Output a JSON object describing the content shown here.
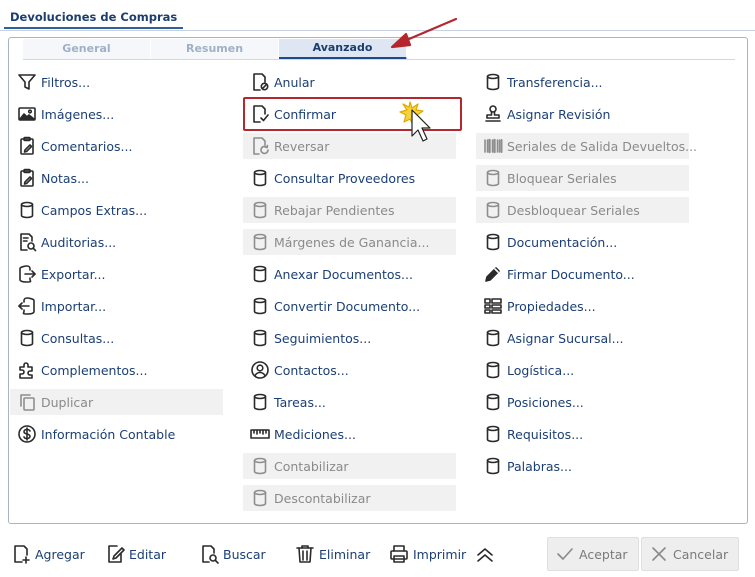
{
  "window": {
    "title": "Devoluciones de Compras"
  },
  "tabs": [
    {
      "label": "General",
      "active": false
    },
    {
      "label": "Resumen",
      "active": false
    },
    {
      "label": "Avanzado",
      "active": true
    }
  ],
  "columns": {
    "left": [
      {
        "label": "Filtros...",
        "icon": "funnel-icon",
        "enabled": true
      },
      {
        "label": "Imágenes...",
        "icon": "image-icon",
        "enabled": true
      },
      {
        "label": "Comentarios...",
        "icon": "clipboard-edit-icon",
        "enabled": true
      },
      {
        "label": "Notas...",
        "icon": "clipboard-edit-icon",
        "enabled": true
      },
      {
        "label": "Campos Extras...",
        "icon": "database-icon",
        "enabled": true
      },
      {
        "label": "Auditorias...",
        "icon": "audit-search-icon",
        "enabled": true
      },
      {
        "label": "Exportar...",
        "icon": "export-icon",
        "enabled": true
      },
      {
        "label": "Importar...",
        "icon": "import-icon",
        "enabled": true
      },
      {
        "label": "Consultas...",
        "icon": "database-icon",
        "enabled": true
      },
      {
        "label": "Complementos...",
        "icon": "puzzle-icon",
        "enabled": true
      },
      {
        "label": "Duplicar",
        "icon": "duplicate-icon",
        "enabled": false
      },
      {
        "label": "Información Contable",
        "icon": "dollar-circle-icon",
        "enabled": true
      }
    ],
    "middle": [
      {
        "label": "Anular",
        "icon": "document-cancel-icon",
        "enabled": true
      },
      {
        "label": "Confirmar",
        "icon": "document-check-icon",
        "enabled": true
      },
      {
        "label": "Reversar",
        "icon": "document-revert-icon",
        "enabled": false
      },
      {
        "label": "Consultar Proveedores",
        "icon": "database-icon",
        "enabled": true
      },
      {
        "label": "Rebajar Pendientes",
        "icon": "database-icon",
        "enabled": false
      },
      {
        "label": "Márgenes de Ganancia...",
        "icon": "database-icon",
        "enabled": false
      },
      {
        "label": "Anexar Documentos...",
        "icon": "database-icon",
        "enabled": true
      },
      {
        "label": "Convertir Documento...",
        "icon": "database-icon",
        "enabled": true
      },
      {
        "label": "Seguimientos...",
        "icon": "database-icon",
        "enabled": true
      },
      {
        "label": "Contactos...",
        "icon": "user-circle-icon",
        "enabled": true
      },
      {
        "label": "Tareas...",
        "icon": "database-icon",
        "enabled": true
      },
      {
        "label": "Mediciones...",
        "icon": "ruler-icon",
        "enabled": true
      },
      {
        "label": "Contabilizar",
        "icon": "database-icon",
        "enabled": false
      },
      {
        "label": "Descontabilizar",
        "icon": "database-icon",
        "enabled": false
      }
    ],
    "right": [
      {
        "label": "Transferencia...",
        "icon": "database-icon",
        "enabled": true
      },
      {
        "label": "Asignar Revisión",
        "icon": "stamp-icon",
        "enabled": true
      },
      {
        "label": "Seriales de Salida Devueltos...",
        "icon": "barcode-icon",
        "enabled": false
      },
      {
        "label": "Bloquear Seriales",
        "icon": "database-icon",
        "enabled": false
      },
      {
        "label": "Desbloquear Seriales",
        "icon": "database-icon",
        "enabled": false
      },
      {
        "label": "Documentación...",
        "icon": "database-icon",
        "enabled": true
      },
      {
        "label": "Firmar Documento...",
        "icon": "pen-icon",
        "enabled": true
      },
      {
        "label": "Propiedades...",
        "icon": "properties-list-icon",
        "enabled": true
      },
      {
        "label": "Asignar Sucursal...",
        "icon": "database-icon",
        "enabled": true
      },
      {
        "label": "Logística...",
        "icon": "database-icon",
        "enabled": true
      },
      {
        "label": "Posiciones...",
        "icon": "database-icon",
        "enabled": true
      },
      {
        "label": "Requisitos...",
        "icon": "database-icon",
        "enabled": true
      },
      {
        "label": "Palabras...",
        "icon": "database-icon",
        "enabled": true
      }
    ]
  },
  "footer": {
    "add": "Agregar",
    "edit": "Editar",
    "search": "Buscar",
    "delete": "Eliminar",
    "print": "Imprimir",
    "accept": "Aceptar",
    "cancel": "Cancelar"
  },
  "colors": {
    "link": "#1b3f73",
    "disabled_bg": "#f1f1f1",
    "highlight": "#b3272d",
    "tab_active": "#1c4a8a"
  }
}
